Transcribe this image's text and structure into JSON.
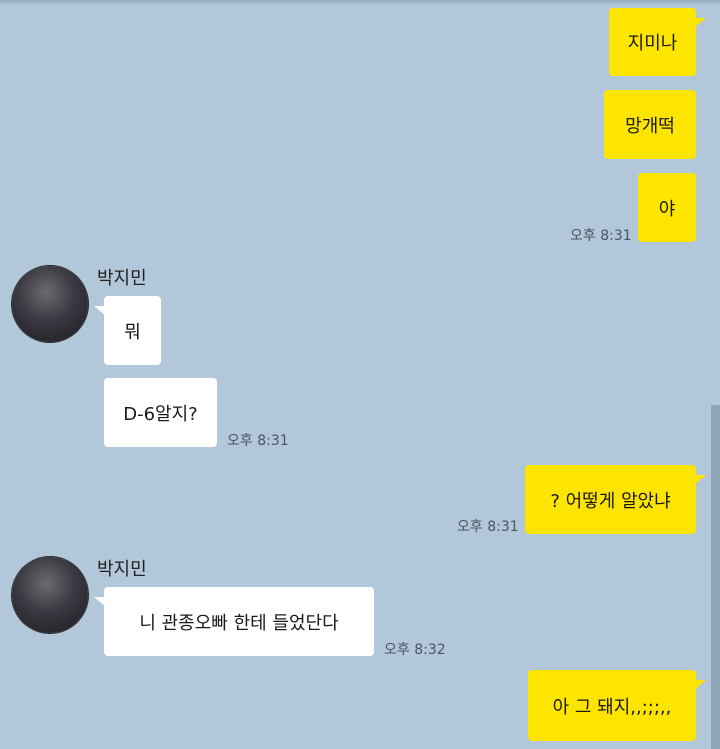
{
  "messages": {
    "m1": {
      "text": "지미나"
    },
    "m2": {
      "text": "망개떡"
    },
    "m3": {
      "text": "야",
      "time": "오후 8:31"
    },
    "m4": {
      "sender": "박지민",
      "text": "뭐"
    },
    "m5": {
      "text": "D-6알지?",
      "time": "오후 8:31"
    },
    "m6": {
      "text": "? 어떻게 알았냐",
      "time": "오후 8:31"
    },
    "m7": {
      "sender": "박지민",
      "text": "니 관종오빠 한테 들었단다",
      "time": "오후 8:32"
    },
    "m8": {
      "text": "아 그 돼지,,;;;,,"
    }
  },
  "colors": {
    "background": "#b2c7d9",
    "my_bubble": "#fee500",
    "other_bubble": "#ffffff"
  },
  "icons": {
    "avatar": "profile-avatar"
  }
}
